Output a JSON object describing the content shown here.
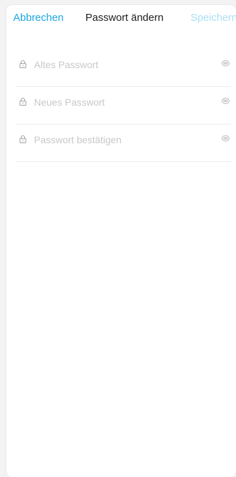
{
  "header": {
    "cancel_label": "Abbrechen",
    "title": "Passwort ändern",
    "save_label": "Speichern"
  },
  "fields": [
    {
      "placeholder": "Altes Passwort",
      "value": "",
      "lock_icon": "lock-icon",
      "toggle_icon": "eye-icon"
    },
    {
      "placeholder": "Neues Passwort",
      "value": "",
      "lock_icon": "lock-icon",
      "toggle_icon": "eye-icon"
    },
    {
      "placeholder": "Passwort bestätigen",
      "value": "",
      "lock_icon": "lock-icon",
      "toggle_icon": "eye-icon"
    }
  ],
  "colors": {
    "accent": "#1aa6e4",
    "accent_disabled": "#a9dff5",
    "title": "#1d1d1d",
    "placeholder": "#c8c8c8",
    "divider": "#ececec"
  }
}
